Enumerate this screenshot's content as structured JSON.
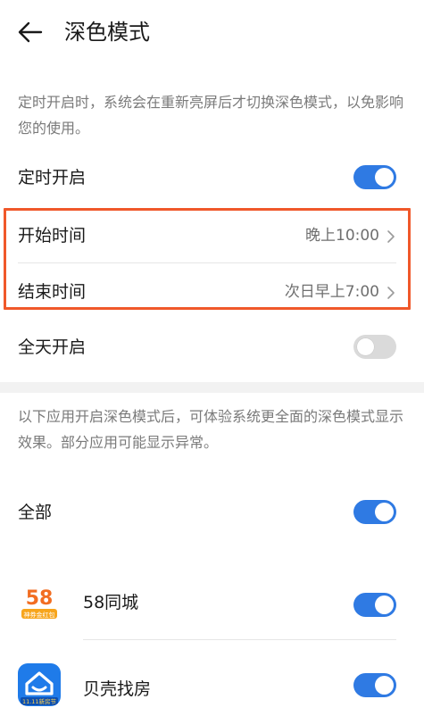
{
  "header": {
    "title": "深色模式",
    "back_icon": "back-arrow-icon"
  },
  "schedule_note": "定时开启时，系统会在重新亮屏后才切换深色模式，以免影响您的使用。",
  "scheduled": {
    "label": "定时开启",
    "enabled": true
  },
  "start_time": {
    "label": "开始时间",
    "value": "晚上10:00"
  },
  "end_time": {
    "label": "结束时间",
    "value": "次日早上7:00"
  },
  "all_day": {
    "label": "全天开启",
    "enabled": false
  },
  "apps_note": "以下应用开启深色模式后，可体验系统更全面的深色模式显示效果。部分应用可能显示异常。",
  "all_apps": {
    "label": "全部",
    "enabled": true
  },
  "apps": [
    {
      "name": "58同城",
      "enabled": true,
      "icon": "58-tongcheng-app-icon",
      "icon_text": "58",
      "icon_badge": "神券金红包"
    },
    {
      "name": "贝壳找房",
      "enabled": true,
      "icon": "beike-app-icon",
      "icon_badge": "11.11新房节"
    }
  ],
  "colors": {
    "accent": "#2f7ae3",
    "highlight": "#f0582a"
  }
}
